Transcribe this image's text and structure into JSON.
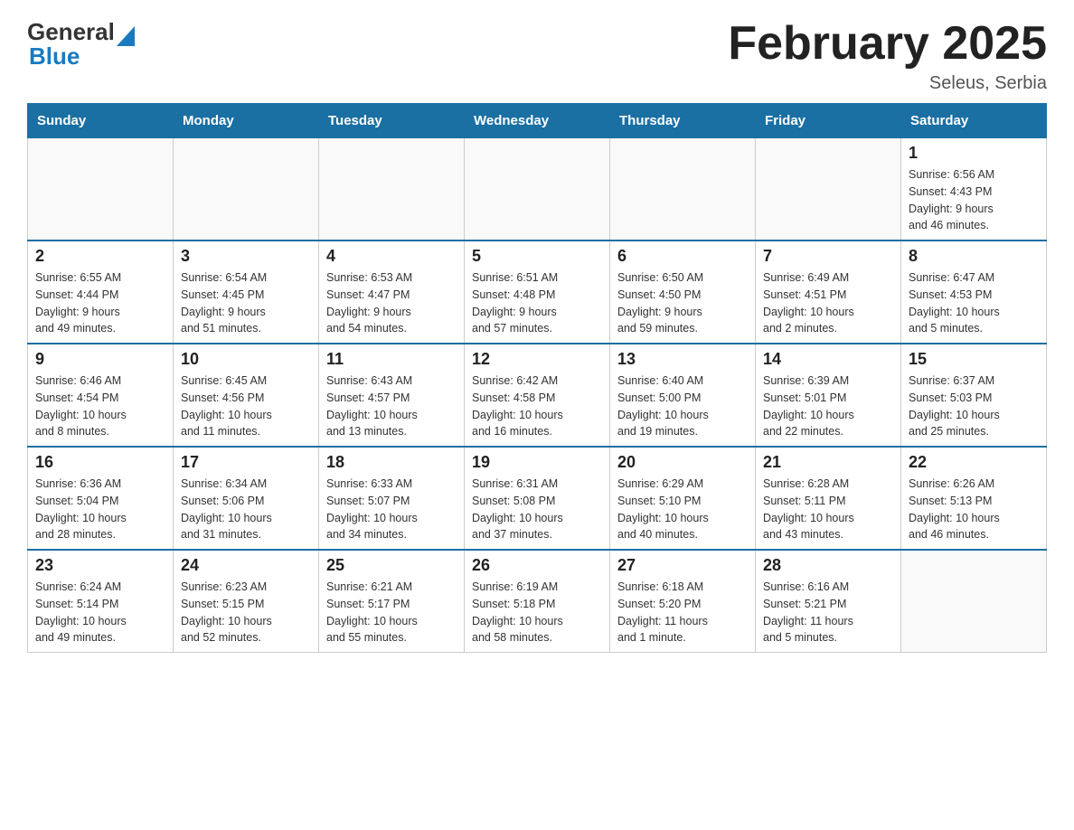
{
  "logo": {
    "general": "General",
    "blue": "Blue"
  },
  "header": {
    "title": "February 2025",
    "subtitle": "Seleus, Serbia"
  },
  "weekdays": [
    "Sunday",
    "Monday",
    "Tuesday",
    "Wednesday",
    "Thursday",
    "Friday",
    "Saturday"
  ],
  "weeks": [
    [
      {
        "day": "",
        "info": ""
      },
      {
        "day": "",
        "info": ""
      },
      {
        "day": "",
        "info": ""
      },
      {
        "day": "",
        "info": ""
      },
      {
        "day": "",
        "info": ""
      },
      {
        "day": "",
        "info": ""
      },
      {
        "day": "1",
        "info": "Sunrise: 6:56 AM\nSunset: 4:43 PM\nDaylight: 9 hours\nand 46 minutes."
      }
    ],
    [
      {
        "day": "2",
        "info": "Sunrise: 6:55 AM\nSunset: 4:44 PM\nDaylight: 9 hours\nand 49 minutes."
      },
      {
        "day": "3",
        "info": "Sunrise: 6:54 AM\nSunset: 4:45 PM\nDaylight: 9 hours\nand 51 minutes."
      },
      {
        "day": "4",
        "info": "Sunrise: 6:53 AM\nSunset: 4:47 PM\nDaylight: 9 hours\nand 54 minutes."
      },
      {
        "day": "5",
        "info": "Sunrise: 6:51 AM\nSunset: 4:48 PM\nDaylight: 9 hours\nand 57 minutes."
      },
      {
        "day": "6",
        "info": "Sunrise: 6:50 AM\nSunset: 4:50 PM\nDaylight: 9 hours\nand 59 minutes."
      },
      {
        "day": "7",
        "info": "Sunrise: 6:49 AM\nSunset: 4:51 PM\nDaylight: 10 hours\nand 2 minutes."
      },
      {
        "day": "8",
        "info": "Sunrise: 6:47 AM\nSunset: 4:53 PM\nDaylight: 10 hours\nand 5 minutes."
      }
    ],
    [
      {
        "day": "9",
        "info": "Sunrise: 6:46 AM\nSunset: 4:54 PM\nDaylight: 10 hours\nand 8 minutes."
      },
      {
        "day": "10",
        "info": "Sunrise: 6:45 AM\nSunset: 4:56 PM\nDaylight: 10 hours\nand 11 minutes."
      },
      {
        "day": "11",
        "info": "Sunrise: 6:43 AM\nSunset: 4:57 PM\nDaylight: 10 hours\nand 13 minutes."
      },
      {
        "day": "12",
        "info": "Sunrise: 6:42 AM\nSunset: 4:58 PM\nDaylight: 10 hours\nand 16 minutes."
      },
      {
        "day": "13",
        "info": "Sunrise: 6:40 AM\nSunset: 5:00 PM\nDaylight: 10 hours\nand 19 minutes."
      },
      {
        "day": "14",
        "info": "Sunrise: 6:39 AM\nSunset: 5:01 PM\nDaylight: 10 hours\nand 22 minutes."
      },
      {
        "day": "15",
        "info": "Sunrise: 6:37 AM\nSunset: 5:03 PM\nDaylight: 10 hours\nand 25 minutes."
      }
    ],
    [
      {
        "day": "16",
        "info": "Sunrise: 6:36 AM\nSunset: 5:04 PM\nDaylight: 10 hours\nand 28 minutes."
      },
      {
        "day": "17",
        "info": "Sunrise: 6:34 AM\nSunset: 5:06 PM\nDaylight: 10 hours\nand 31 minutes."
      },
      {
        "day": "18",
        "info": "Sunrise: 6:33 AM\nSunset: 5:07 PM\nDaylight: 10 hours\nand 34 minutes."
      },
      {
        "day": "19",
        "info": "Sunrise: 6:31 AM\nSunset: 5:08 PM\nDaylight: 10 hours\nand 37 minutes."
      },
      {
        "day": "20",
        "info": "Sunrise: 6:29 AM\nSunset: 5:10 PM\nDaylight: 10 hours\nand 40 minutes."
      },
      {
        "day": "21",
        "info": "Sunrise: 6:28 AM\nSunset: 5:11 PM\nDaylight: 10 hours\nand 43 minutes."
      },
      {
        "day": "22",
        "info": "Sunrise: 6:26 AM\nSunset: 5:13 PM\nDaylight: 10 hours\nand 46 minutes."
      }
    ],
    [
      {
        "day": "23",
        "info": "Sunrise: 6:24 AM\nSunset: 5:14 PM\nDaylight: 10 hours\nand 49 minutes."
      },
      {
        "day": "24",
        "info": "Sunrise: 6:23 AM\nSunset: 5:15 PM\nDaylight: 10 hours\nand 52 minutes."
      },
      {
        "day": "25",
        "info": "Sunrise: 6:21 AM\nSunset: 5:17 PM\nDaylight: 10 hours\nand 55 minutes."
      },
      {
        "day": "26",
        "info": "Sunrise: 6:19 AM\nSunset: 5:18 PM\nDaylight: 10 hours\nand 58 minutes."
      },
      {
        "day": "27",
        "info": "Sunrise: 6:18 AM\nSunset: 5:20 PM\nDaylight: 11 hours\nand 1 minute."
      },
      {
        "day": "28",
        "info": "Sunrise: 6:16 AM\nSunset: 5:21 PM\nDaylight: 11 hours\nand 5 minutes."
      },
      {
        "day": "",
        "info": ""
      }
    ]
  ]
}
